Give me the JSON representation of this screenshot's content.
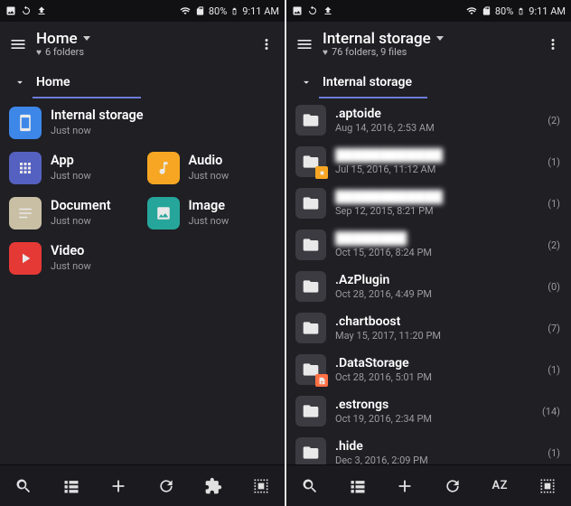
{
  "statusbar": {
    "battery_pct": "80%",
    "time": "9:11 AM"
  },
  "left": {
    "title": "Home",
    "subtitle": "6 folders",
    "breadcrumb": "Home",
    "categories": [
      {
        "label": "Internal storage",
        "sub": "Just now"
      },
      {
        "label": "App",
        "sub": "Just now"
      },
      {
        "label": "Audio",
        "sub": "Just now"
      },
      {
        "label": "Document",
        "sub": "Just now"
      },
      {
        "label": "Image",
        "sub": "Just now"
      },
      {
        "label": "Video",
        "sub": "Just now"
      }
    ]
  },
  "right": {
    "title": "Internal storage",
    "subtitle": "76 folders, 9 files",
    "breadcrumb": "Internal storage",
    "items": [
      {
        "name": ".aptoide",
        "date": "Aug 14, 2016, 2:53 AM",
        "count": "(2)"
      },
      {
        "name": "████████████",
        "date": "Jul 15, 2016, 11:12 AM",
        "count": "(1)",
        "blurred": true,
        "badge": "orange"
      },
      {
        "name": "████████████",
        "date": "Sep 12, 2015, 8:21 PM",
        "count": "(1)",
        "blurred": true
      },
      {
        "name": "████████",
        "date": "Oct 15, 2016, 8:24 PM",
        "count": "(2)",
        "blurred": true
      },
      {
        "name": ".AzPlugin",
        "date": "Oct 28, 2016, 4:49 PM",
        "count": "(0)"
      },
      {
        "name": ".chartboost",
        "date": "May 15, 2017, 11:20 PM",
        "count": "(7)"
      },
      {
        "name": ".DataStorage",
        "date": "Oct 28, 2016, 5:01 PM",
        "count": "(1)",
        "badge": "orange2"
      },
      {
        "name": ".estrongs",
        "date": "Oct 19, 2016, 2:34 PM",
        "count": "(14)"
      },
      {
        "name": ".hide",
        "date": "Dec 3, 2016, 2:09 PM",
        "count": "(1)"
      }
    ]
  },
  "bottom_right_label": "AZ"
}
